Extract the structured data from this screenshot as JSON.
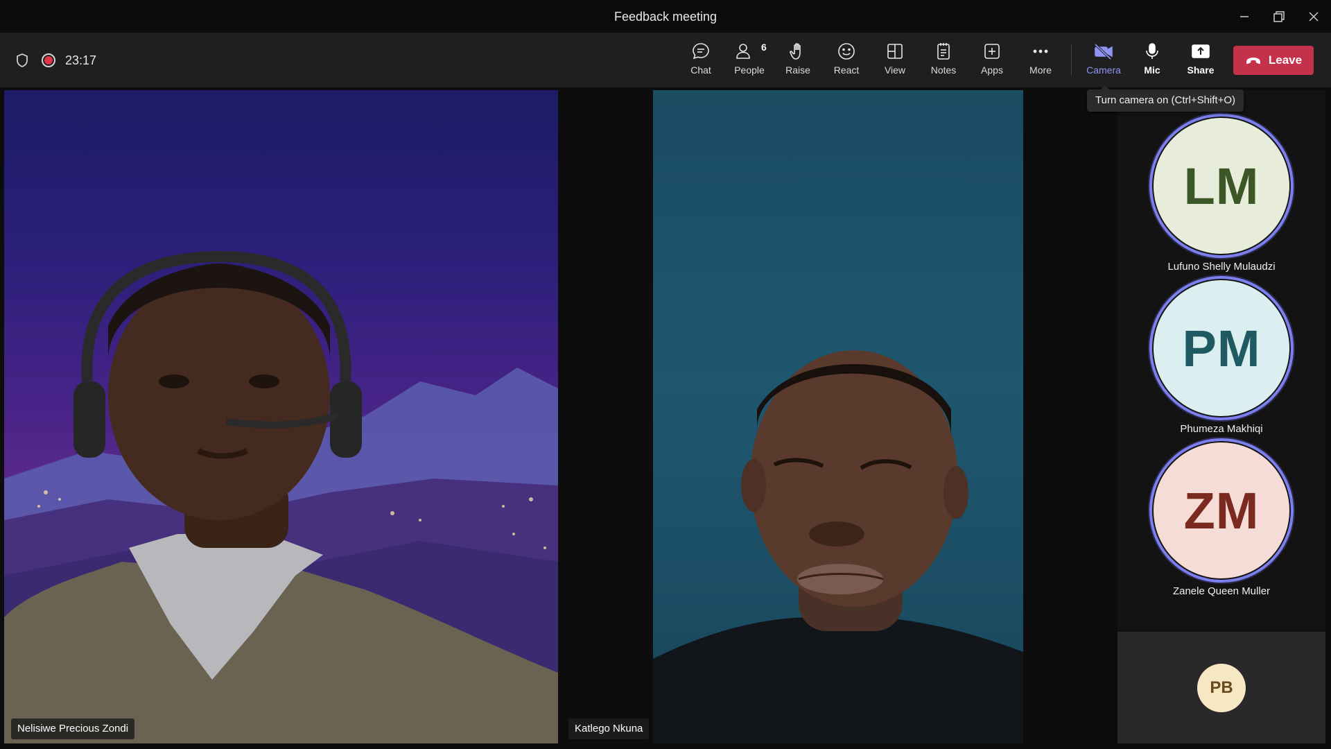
{
  "window": {
    "title": "Feedback meeting"
  },
  "status": {
    "timer": "23:17"
  },
  "toolbar": {
    "chat_label": "Chat",
    "people_label": "People",
    "people_count": "6",
    "raise_label": "Raise",
    "react_label": "React",
    "view_label": "View",
    "notes_label": "Notes",
    "apps_label": "Apps",
    "more_label": "More",
    "camera_label": "Camera",
    "mic_label": "Mic",
    "share_label": "Share",
    "leave_label": "Leave"
  },
  "tooltip": {
    "text": "Turn camera on (Ctrl+Shift+O)"
  },
  "videos": [
    {
      "name": "Nelisiwe Precious Zondi"
    },
    {
      "name": "Katlego Nkuna"
    }
  ],
  "participants": [
    {
      "initials": "LM",
      "name": "Lufuno Shelly Mulaudzi",
      "bg": "#e7edda",
      "fg": "#3c5726"
    },
    {
      "initials": "PM",
      "name": "Phumeza Makhiqi",
      "bg": "#dbeef0",
      "fg": "#1f5a63"
    },
    {
      "initials": "ZM",
      "name": "Zanele Queen Muller",
      "bg": "#f6dcd6",
      "fg": "#7a2a1f"
    }
  ],
  "extra_participant": {
    "initials": "PB"
  },
  "colors": {
    "accent": "#8f95f5",
    "leave": "#c4314b",
    "speaking_ring": "#7c80ee"
  }
}
